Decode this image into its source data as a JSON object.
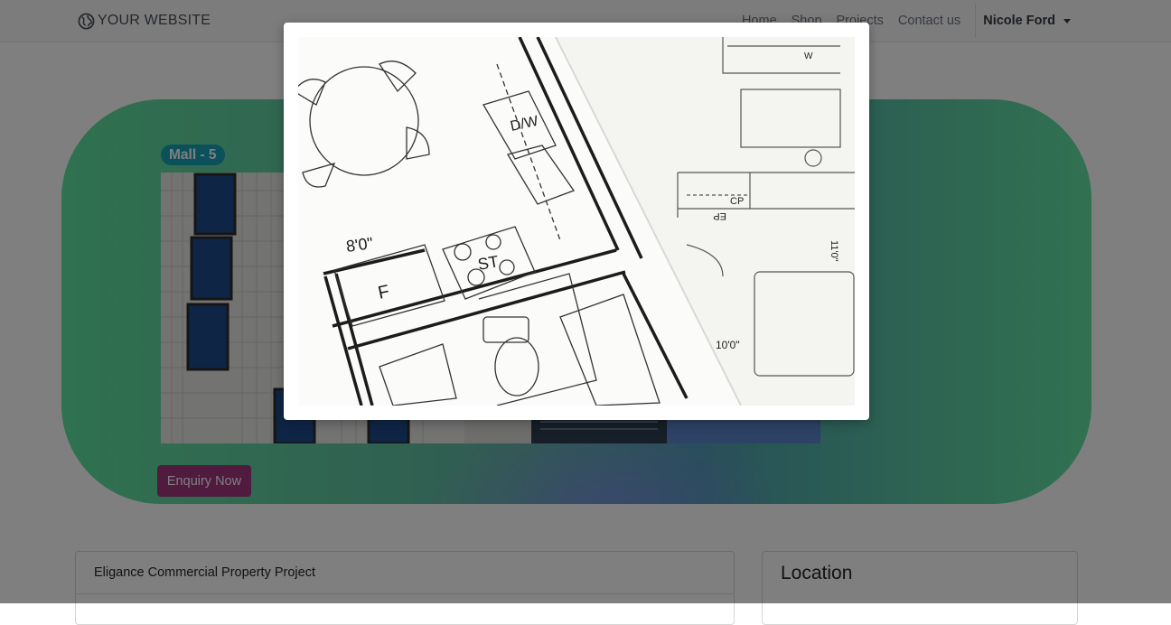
{
  "navbar": {
    "brand": "YOUR WEBSITE",
    "brand_icon": "globe-icon",
    "links": [
      "Home",
      "Shop",
      "Projects",
      "Contact us"
    ],
    "user": "Nicole Ford"
  },
  "hero": {
    "badge": "Mall - 5",
    "enquiry_label": "Enquiry Now",
    "image": "building-facade-photo"
  },
  "project_card": {
    "title": "Eligance Commercial Property Project"
  },
  "location_card": {
    "title": "Location"
  },
  "modal": {
    "image": "floor-plan-blueprint-photo",
    "labels": [
      "D/W",
      "8'0\"",
      "F",
      "ST",
      "CP",
      "EP",
      "11'0\"",
      "10'0\"",
      "W"
    ]
  },
  "colors": {
    "badge": "#17a2b8",
    "enquiry_button": "#a2347f",
    "hero_gradient_start": "#5fe3a1",
    "hero_gradient_end": "#63e3a2"
  }
}
